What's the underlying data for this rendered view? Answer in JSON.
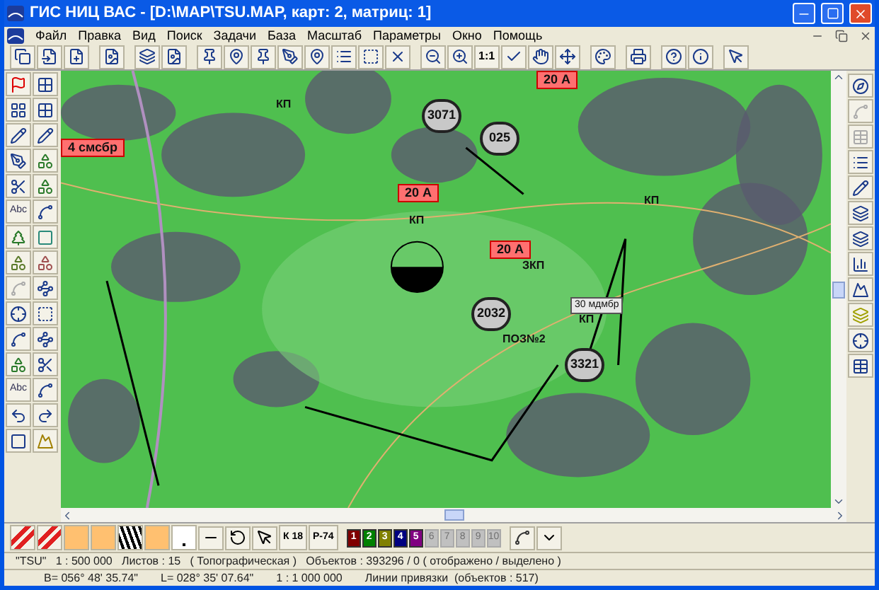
{
  "window": {
    "title": "ГИС НИЦ ВАС - [D:\\MAP\\TSU.MAP, карт: 2, матриц: 1]"
  },
  "menu": [
    "Файл",
    "Правка",
    "Вид",
    "Поиск",
    "Задачи",
    "База",
    "Масштаб",
    "Параметры",
    "Окно",
    "Помощь"
  ],
  "toolbar": {
    "scale_button": "1:1"
  },
  "left_toolbar": {
    "text_tools": [
      "Abc",
      "Abc"
    ]
  },
  "map": {
    "markers": [
      {
        "kind": "circle",
        "text": "3071"
      },
      {
        "kind": "circle",
        "text": "025"
      },
      {
        "kind": "circle",
        "text": "2032"
      },
      {
        "kind": "circle",
        "text": "3321"
      },
      {
        "kind": "flag",
        "text": "20 А"
      },
      {
        "kind": "flag",
        "text": "20 А"
      },
      {
        "kind": "flag",
        "text": "20 А"
      },
      {
        "kind": "flag",
        "text": "4 смсбр"
      },
      {
        "kind": "box",
        "text": "30 мдмбр"
      },
      {
        "kind": "label",
        "text": "КП"
      },
      {
        "kind": "label",
        "text": "КП"
      },
      {
        "kind": "label",
        "text": "КП"
      },
      {
        "kind": "label",
        "text": "КП"
      },
      {
        "kind": "label",
        "text": "ЗКП"
      },
      {
        "kind": "label",
        "text": "ПОЗ№2"
      }
    ]
  },
  "bottom_toolbar": {
    "sheet_buttons": [
      "К 18",
      "Р-74"
    ],
    "layers": [
      {
        "label": "1",
        "color": "#800000",
        "disabled": false
      },
      {
        "label": "2",
        "color": "#008000",
        "disabled": false
      },
      {
        "label": "3",
        "color": "#808000",
        "disabled": false
      },
      {
        "label": "4",
        "color": "#000080",
        "disabled": false
      },
      {
        "label": "5",
        "color": "#800080",
        "disabled": false
      },
      {
        "label": "6",
        "color": "#c0c0c0",
        "disabled": true
      },
      {
        "label": "7",
        "color": "#c0c0c0",
        "disabled": true
      },
      {
        "label": "8",
        "color": "#c0c0c0",
        "disabled": true
      },
      {
        "label": "9",
        "color": "#c0c0c0",
        "disabled": true
      },
      {
        "label": "10",
        "color": "#c0c0c0",
        "disabled": true
      }
    ]
  },
  "status_bar": {
    "map_info": "\"TSU\"   1 : 500 000   Листов : 15   ( Топографическая )   Объектов : 393296 / 0 ( отображено / выделено )",
    "cursor_info": [
      "B= 056° 48' 35.74\"",
      "L= 028° 35' 07.64\"",
      "1 : 1 000 000",
      "Линии привязки  (объектов : 517)"
    ]
  }
}
